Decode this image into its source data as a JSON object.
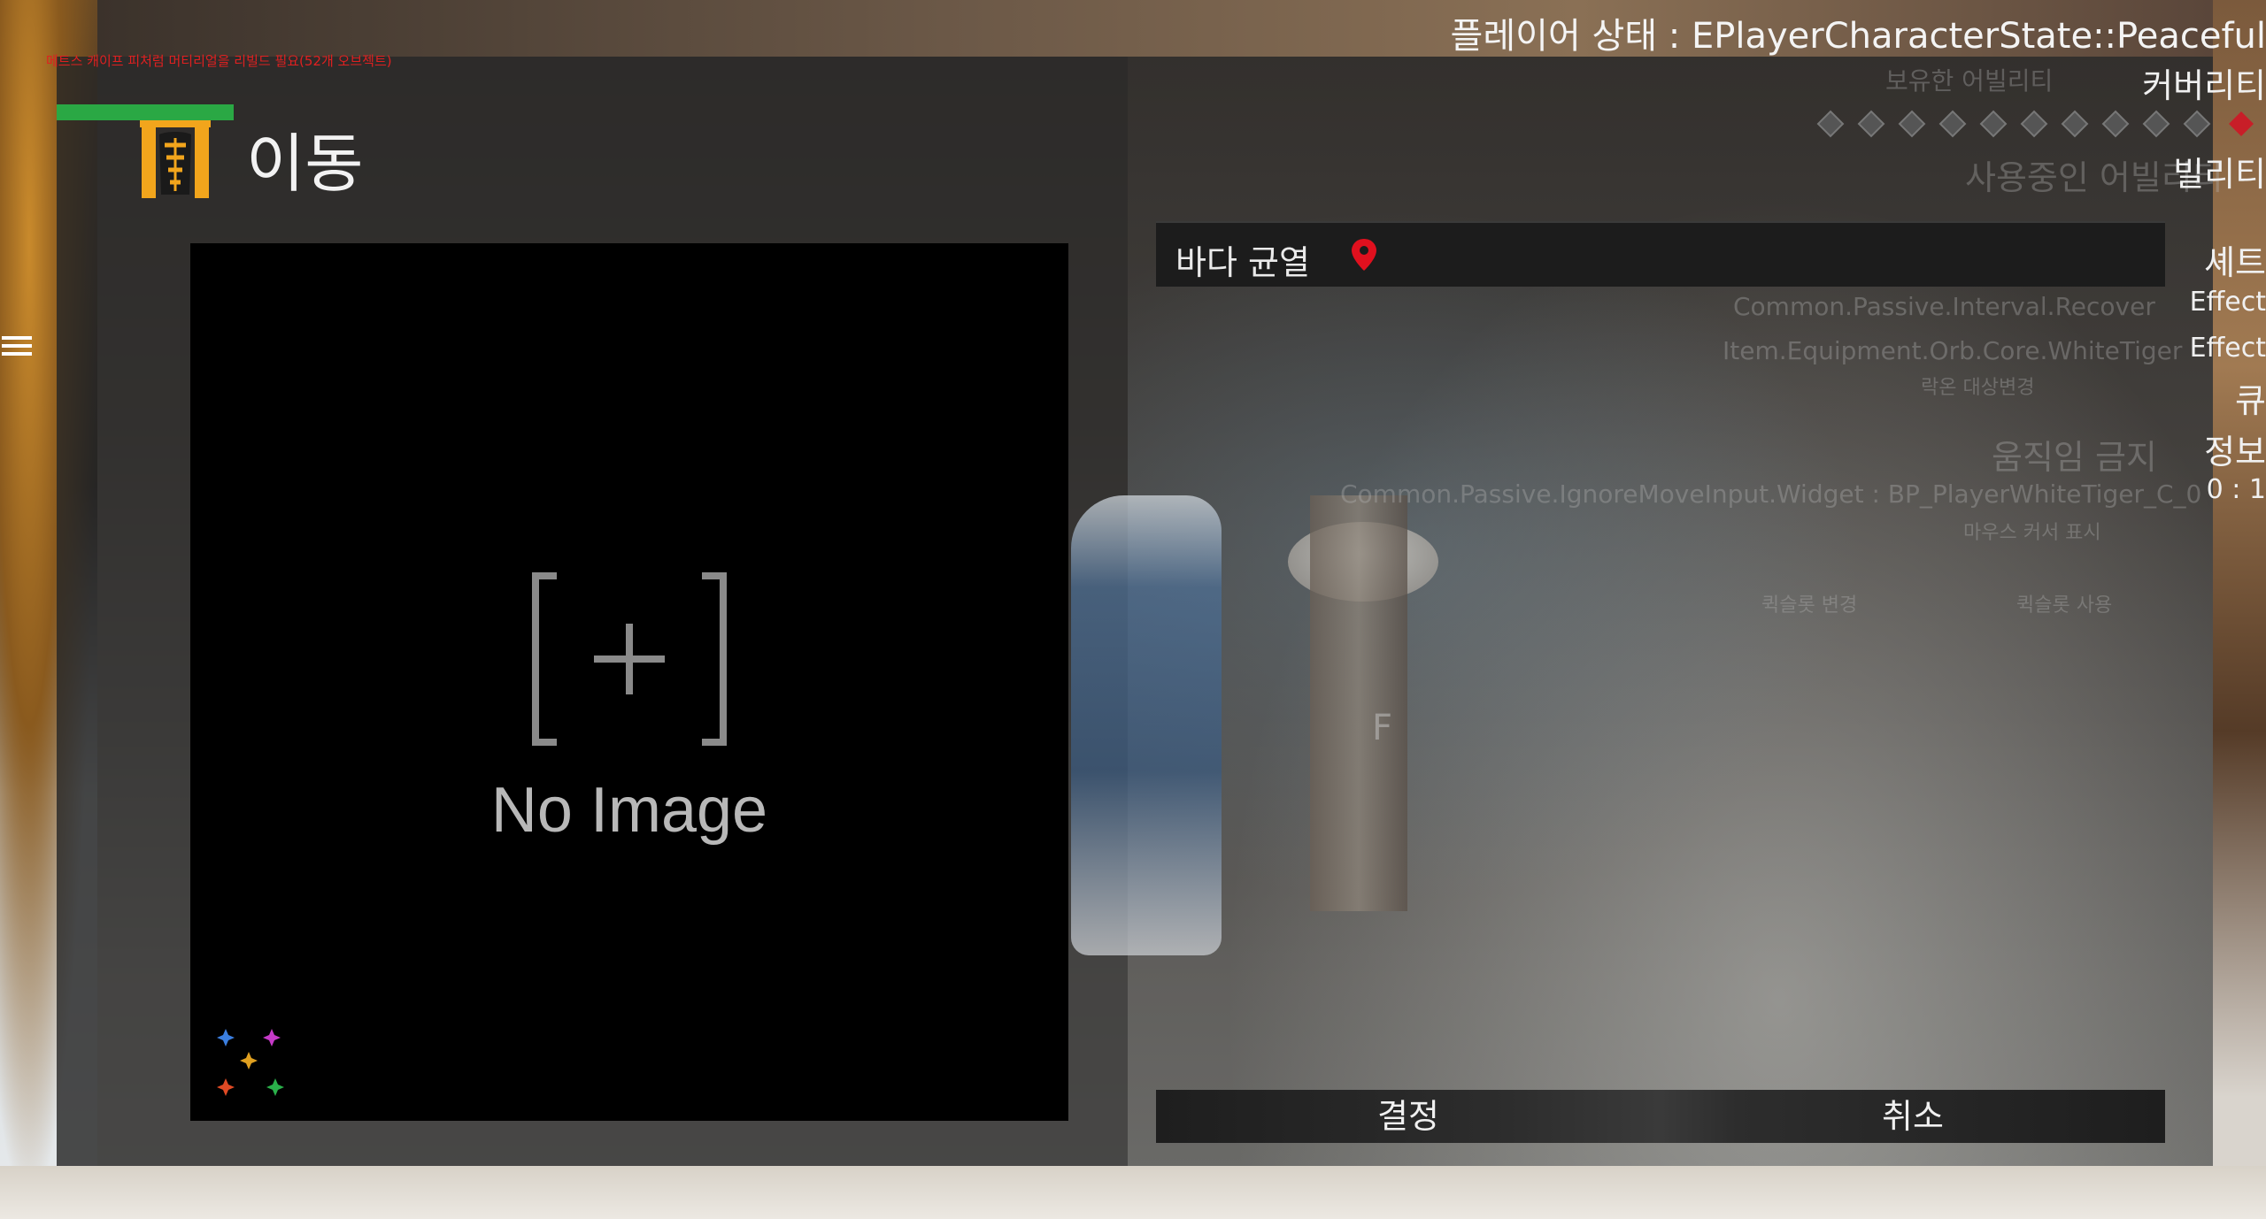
{
  "window": {
    "title": "이동"
  },
  "debug": {
    "player_state_label": "플레이어 상태 : EPlayerCharacterState::Peaceful",
    "warning": "메트스 캐이프 피처럼 머티리얼을 리빌드 필요(52개 오브젝트)",
    "side_fragments": [
      "커버리티",
      "빌리티",
      "셰트",
      "Effect",
      "Effect",
      "큐",
      "정보",
      "0 : 1"
    ]
  },
  "background_ghost_text": {
    "ability_owned": "보유한 어빌리티",
    "ability_active": "사용중인 어빌리티",
    "effect_line_1": "Common.Passive.Interval.Recover",
    "effect_line_2": "Item.Equipment.Orb.Core.WhiteTiger",
    "target_change": "락온 대상변경",
    "move_forbidden": "움직임 금지",
    "widget_line": "Common.Passive.IgnoreMoveInput.Widget : BP_PlayerWhiteTiger_C_0",
    "cursor_show": "마우스 커서 표시",
    "quickslot_change": "퀵슬롯 변경",
    "quickslot_use": "퀵슬롯 사용",
    "interact_key": "F"
  },
  "image_preview": {
    "placeholder_text": "No Image",
    "placeholder_icon": "image-placeholder-icon"
  },
  "location": {
    "name": "바다 균열",
    "icon": "map-pin-icon",
    "pin_color": "#e0101e"
  },
  "actions": {
    "confirm_label": "결정",
    "cancel_label": "취소"
  },
  "colors": {
    "title_icon_orange": "#f2a51c",
    "panel_bg": "#262626"
  }
}
